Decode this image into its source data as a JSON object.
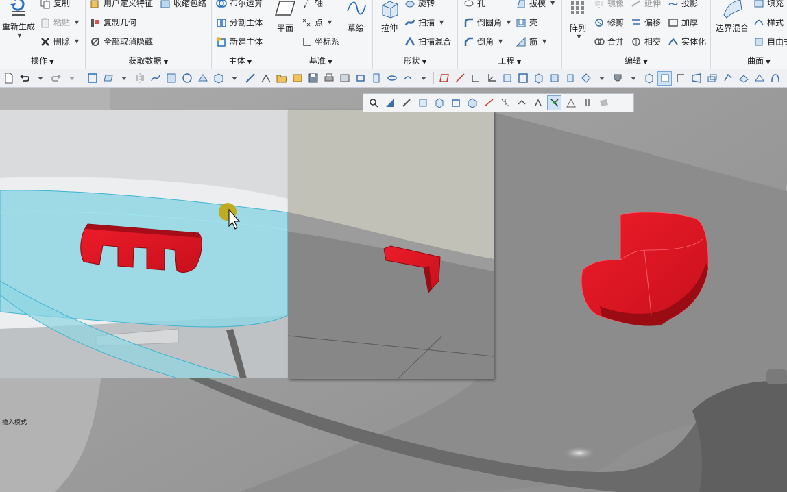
{
  "ribbon": {
    "operations": {
      "label": "操作",
      "regenerate": "重新生成",
      "copy": "复制",
      "paste": "粘贴",
      "delete": "删除"
    },
    "get_data": {
      "label": "获取数据",
      "user_defined_feature": "用户定义特征",
      "shrinkwrap": "收缩包络",
      "copy_geometry": "复制几何",
      "unhide_all": "全部取消隐藏"
    },
    "body": {
      "label": "主体",
      "boolean": "布尔运算",
      "split_body": "分割主体",
      "new_body": "新建主体"
    },
    "datum": {
      "label": "基准",
      "plane": "平面",
      "axis": "轴",
      "point": "点",
      "coordinate_system": "坐标系",
      "sketch": "草绘"
    },
    "shapes": {
      "label": "形状",
      "extrude": "拉伸",
      "revolve": "旋转",
      "sweep": "扫描",
      "swept_blend": "扫描混合"
    },
    "engineering": {
      "label": "工程",
      "hole": "孔",
      "draft": "拔模",
      "round": "倒圆角",
      "shell": "壳",
      "chamfer": "倒角",
      "rib": "筋"
    },
    "editing": {
      "label": "编辑",
      "pattern": "阵列",
      "mirror": "镜像",
      "extend": "延伸",
      "project": "投影",
      "trim": "修剪",
      "offset": "偏移",
      "thicken": "加厚",
      "merge": "合并",
      "intersect": "相交",
      "solidify": "实体化"
    },
    "surfaces": {
      "label": "曲面",
      "boundary_blend": "边界混合",
      "fill": "填充",
      "style": "样式",
      "freestyle": "自由式"
    }
  },
  "status": {
    "mode_text": "插入模式"
  },
  "colors": {
    "highlight": "#e01020",
    "selection": "#9fdde8",
    "ribbon_bg": "#f5f6f8"
  }
}
